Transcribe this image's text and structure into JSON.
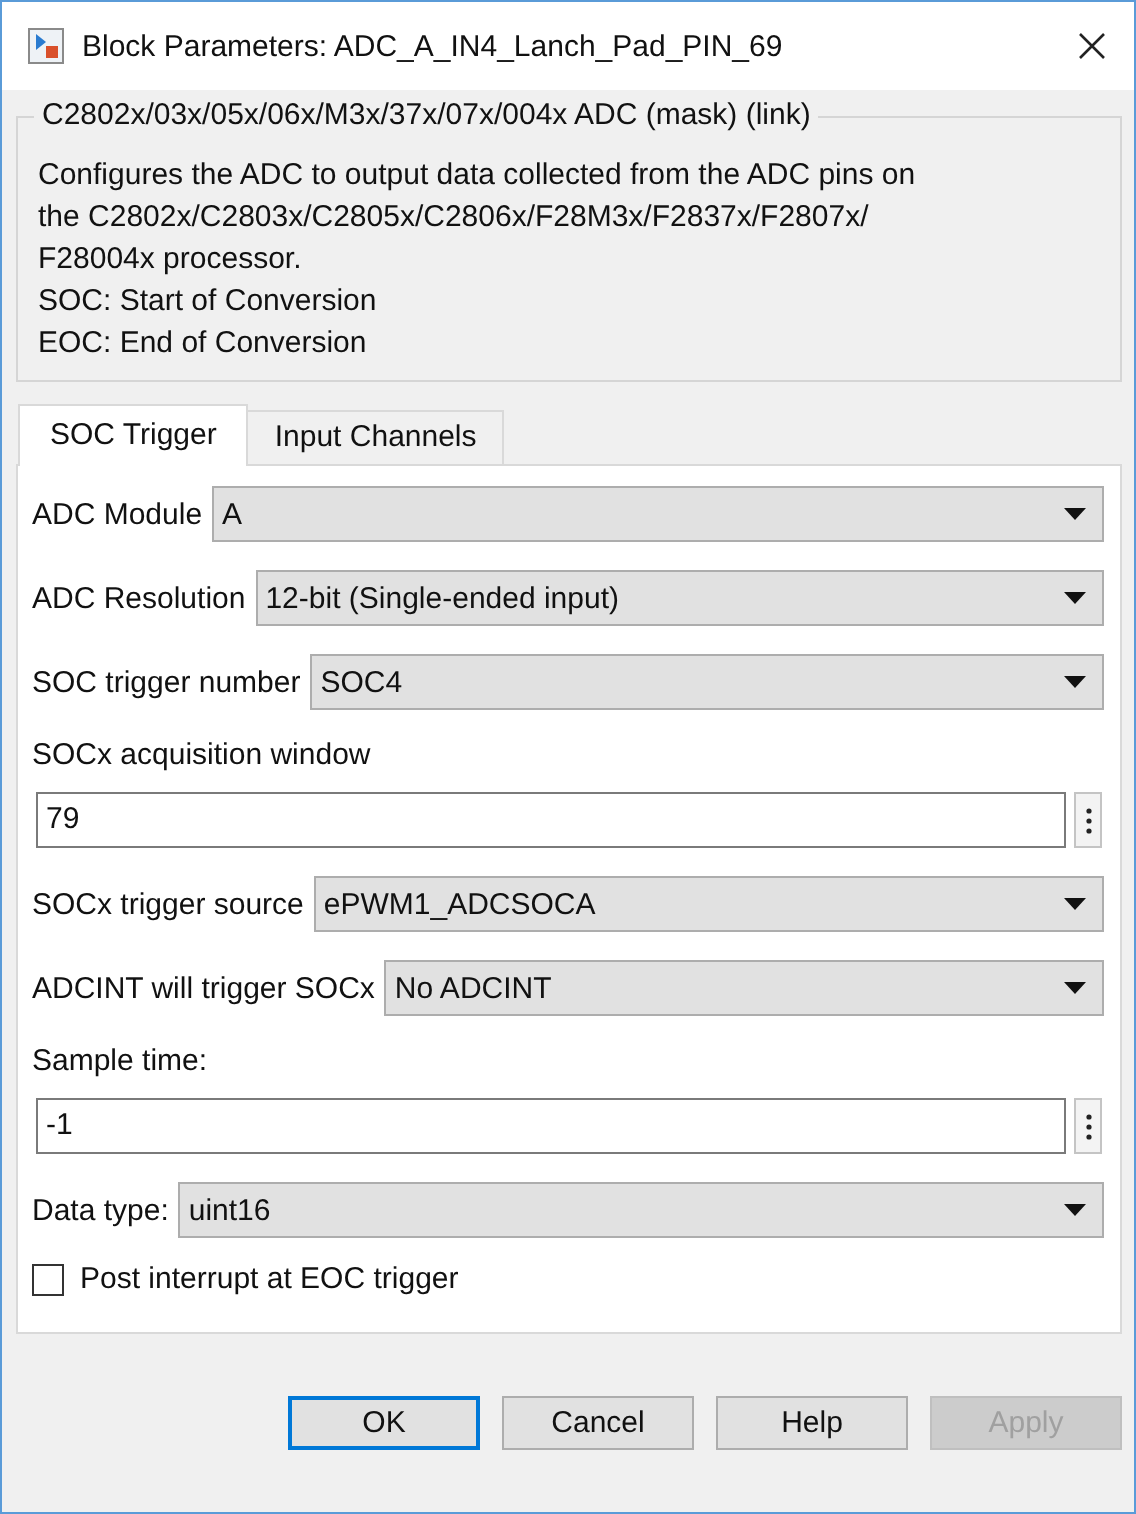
{
  "window": {
    "title": "Block Parameters: ADC_A_IN4_Lanch_Pad_PIN_69"
  },
  "group": {
    "title": "C2802x/03x/05x/06x/M3x/37x/07x/004x ADC (mask) (link)",
    "description": [
      "Configures the ADC to output data collected from the ADC pins on",
      "the C2802x/C2803x/C2805x/C2806x/F28M3x/F2837x/F2807x/",
      "F28004x processor.",
      "SOC: Start of Conversion",
      "EOC: End of Conversion"
    ]
  },
  "tabs": [
    {
      "label": "SOC Trigger",
      "selected": true
    },
    {
      "label": "Input Channels",
      "selected": false
    }
  ],
  "parameters": [
    {
      "kind": "dropdown",
      "label": "ADC Module",
      "value": "A"
    },
    {
      "kind": "dropdown",
      "label": "ADC Resolution",
      "value": "12-bit (Single-ended input)"
    },
    {
      "kind": "dropdown",
      "label": "SOC trigger number",
      "value": "SOC4"
    },
    {
      "kind": "text",
      "label": "SOCx acquisition window",
      "value": "79"
    },
    {
      "kind": "dropdown",
      "label": "SOCx trigger source",
      "value": "ePWM1_ADCSOCA"
    },
    {
      "kind": "dropdown",
      "label": "ADCINT will trigger SOCx",
      "value": "No ADCINT"
    },
    {
      "kind": "text",
      "label": "Sample time:",
      "value": "-1"
    },
    {
      "kind": "dropdown",
      "label": "Data type:",
      "value": "uint16"
    },
    {
      "kind": "checkbox",
      "label": "Post interrupt at EOC trigger",
      "checked": false
    }
  ],
  "buttons": [
    {
      "label": "OK",
      "default": true,
      "disabled": false
    },
    {
      "label": "Cancel",
      "default": false,
      "disabled": false
    },
    {
      "label": "Help",
      "default": false,
      "disabled": false
    },
    {
      "label": "Apply",
      "default": false,
      "disabled": true
    }
  ]
}
